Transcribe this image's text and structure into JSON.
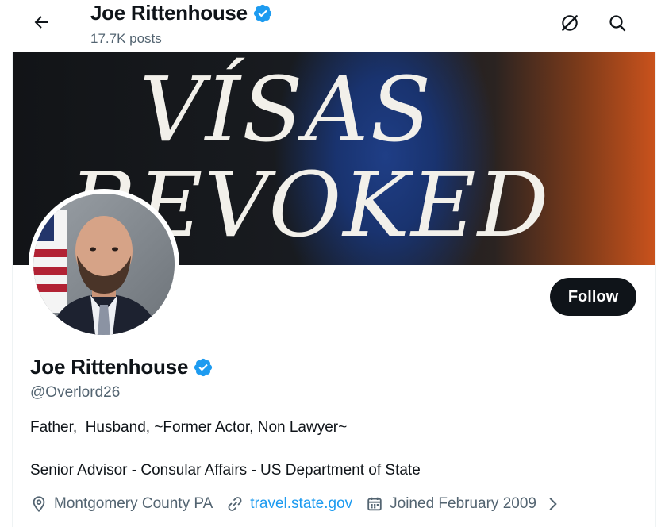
{
  "header": {
    "back_icon": "arrow-left-icon",
    "name": "Joe Rittenhouse",
    "posts": "17.7K posts",
    "action_icons": [
      "grok-icon",
      "search-icon"
    ]
  },
  "banner": {
    "line1": "VÍSAS",
    "line2": "REVOKED"
  },
  "profile": {
    "name": "Joe Rittenhouse",
    "verified_icon": "verified-badge-icon",
    "handle": "@Overlord26",
    "bio_line1": "Father,  Husband, ~Former Actor, Non Lawyer~",
    "bio_line2": "Senior Advisor - Consular Affairs - US Department of State",
    "location": "Montgomery County PA",
    "website": "travel.state.gov",
    "joined": "Joined February 2009"
  },
  "follow_button": {
    "label": "Follow"
  },
  "colors": {
    "accent": "#1d9bf0",
    "text": "#0f1419",
    "secondary": "#536471",
    "button_bg": "#0f1419"
  }
}
